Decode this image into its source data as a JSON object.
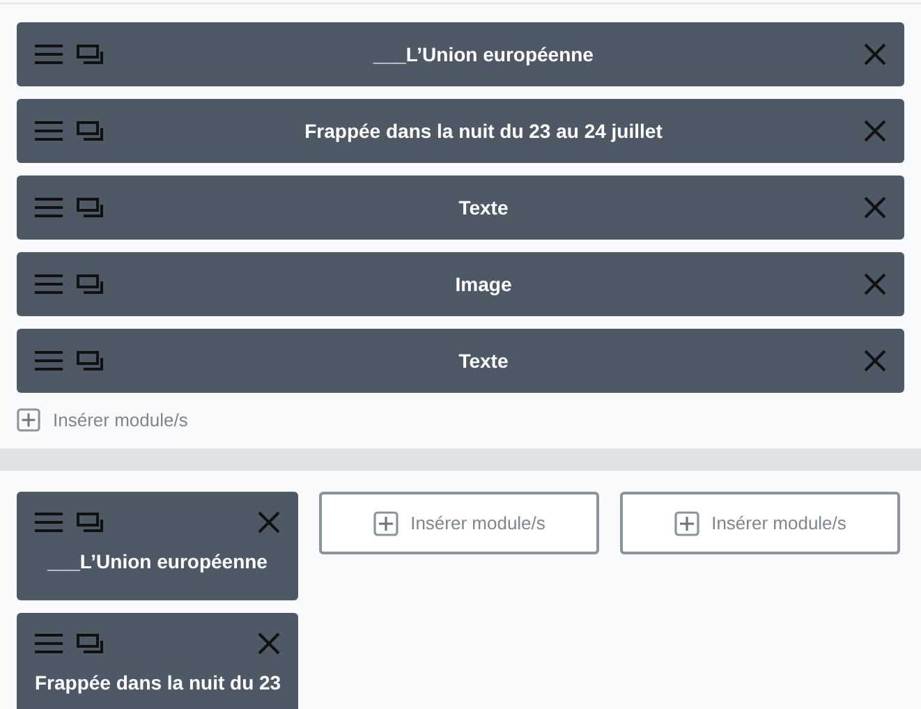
{
  "row_section": {
    "modules": [
      {
        "title": "___L’Union européenne"
      },
      {
        "title": "Frappée dans la nuit du 23 au 24 juillet"
      },
      {
        "title": "Texte"
      },
      {
        "title": "Image"
      },
      {
        "title": "Texte"
      }
    ],
    "insert_label": "Insérer module/s"
  },
  "column_section": {
    "columns": [
      {
        "modules": [
          {
            "title": "___L’Union européenne"
          },
          {
            "title": "Frappée dans la nuit du 23"
          }
        ]
      },
      {
        "insert_label": "Insérer module/s"
      },
      {
        "insert_label": "Insérer module/s"
      }
    ]
  }
}
